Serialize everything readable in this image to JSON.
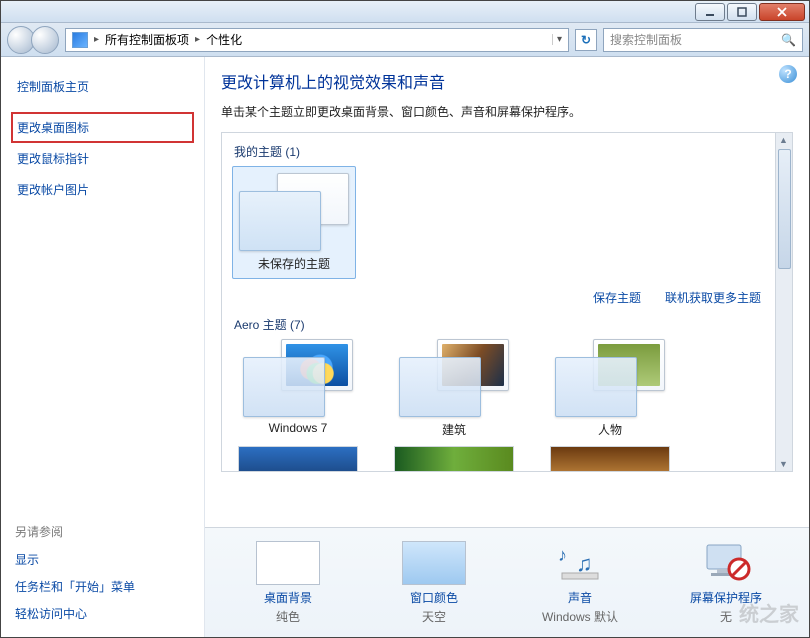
{
  "breadcrumbs": {
    "item1": "所有控制面板项",
    "item2": "个性化"
  },
  "search": {
    "placeholder": "搜索控制面板"
  },
  "sidebar": {
    "home": "控制面板主页",
    "links": [
      {
        "label": "更改桌面图标"
      },
      {
        "label": "更改鼠标指针"
      },
      {
        "label": "更改帐户图片"
      }
    ],
    "related_header": "另请参阅",
    "related": [
      {
        "label": "显示"
      },
      {
        "label": "任务栏和「开始」菜单"
      },
      {
        "label": "轻松访问中心"
      }
    ]
  },
  "page": {
    "title": "更改计算机上的视觉效果和声音",
    "subtitle": "单击某个主题立即更改桌面背景、窗口颜色、声音和屏幕保护程序。"
  },
  "themes": {
    "my_header": "我的主题 (1)",
    "unsaved": "未保存的主题",
    "save_link": "保存主题",
    "more_link": "联机获取更多主题",
    "aero_header": "Aero 主题 (7)",
    "items": [
      {
        "label": "Windows 7"
      },
      {
        "label": "建筑"
      },
      {
        "label": "人物"
      }
    ]
  },
  "bottom": {
    "bg": {
      "title": "桌面背景",
      "sub": "纯色"
    },
    "color": {
      "title": "窗口颜色",
      "sub": "天空"
    },
    "sound": {
      "title": "声音",
      "sub": "Windows 默认"
    },
    "saver": {
      "title": "屏幕保护程序",
      "sub": "无"
    }
  }
}
